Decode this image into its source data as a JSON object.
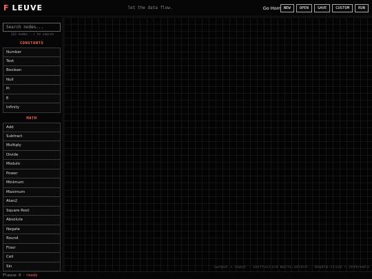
{
  "header": {
    "logo_mark": "F",
    "logo_text": "LEUVE",
    "tagline": "let the data flow.",
    "home_link": "Go Home",
    "buttons": [
      "NEW",
      "OPEN",
      "SAVE",
      "CUSTOM",
      "RUN"
    ]
  },
  "sidebar": {
    "search_placeholder": "Search nodes...",
    "hint": "112 nodes · / to search",
    "sections": [
      {
        "title": "CONSTANTS",
        "items": [
          "Number",
          "Text",
          "Boolean",
          "Null",
          "Pi",
          "E",
          "Infinity"
        ]
      },
      {
        "title": "MATH",
        "items": [
          "Add",
          "Subtract",
          "Multiply",
          "Divide",
          "Modulo",
          "Power",
          "Minimum",
          "Maximum",
          "Atan2",
          "Square Root",
          "Absolute",
          "Negate",
          "Round",
          "Floor",
          "Ceil",
          "Sin"
        ]
      }
    ]
  },
  "canvas": {
    "hint": "output → input · shift+click multi-select · double-click → internals"
  },
  "status": {
    "app": "Fleuve 0",
    "separator": "·",
    "state": "ready"
  },
  "colors": {
    "accent": "#ff6b5e",
    "background": "#000000",
    "border": "#3a3a3a"
  }
}
